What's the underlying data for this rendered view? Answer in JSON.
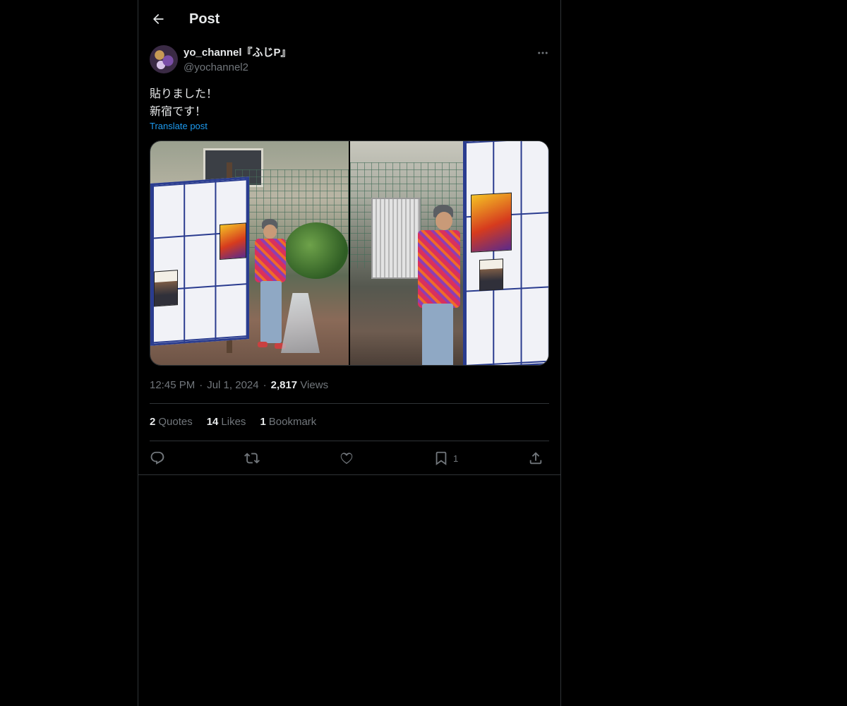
{
  "header": {
    "title": "Post"
  },
  "post": {
    "display_name": "yo_channel『ふじP』",
    "handle": "@yochannel2",
    "text": "貼りました！\n新宿です！",
    "translate_label": "Translate post",
    "time": "12:45 PM",
    "date": "Jul 1, 2024",
    "views_count": "2,817",
    "views_label": "Views",
    "stats": {
      "quotes_count": "2",
      "quotes_label": "Quotes",
      "likes_count": "14",
      "likes_label": "Likes",
      "bookmarks_count": "1",
      "bookmarks_label": "Bookmark"
    },
    "actions": {
      "bookmark_count": "1"
    }
  },
  "icons": [
    "back-arrow-icon",
    "more-icon",
    "reply-icon",
    "repost-icon",
    "like-icon",
    "bookmark-icon",
    "share-icon"
  ],
  "colors": {
    "background": "#000000",
    "text": "#e7e9ea",
    "secondary": "#71767b",
    "accent": "#1d9bf0",
    "border": "#2f3336"
  }
}
